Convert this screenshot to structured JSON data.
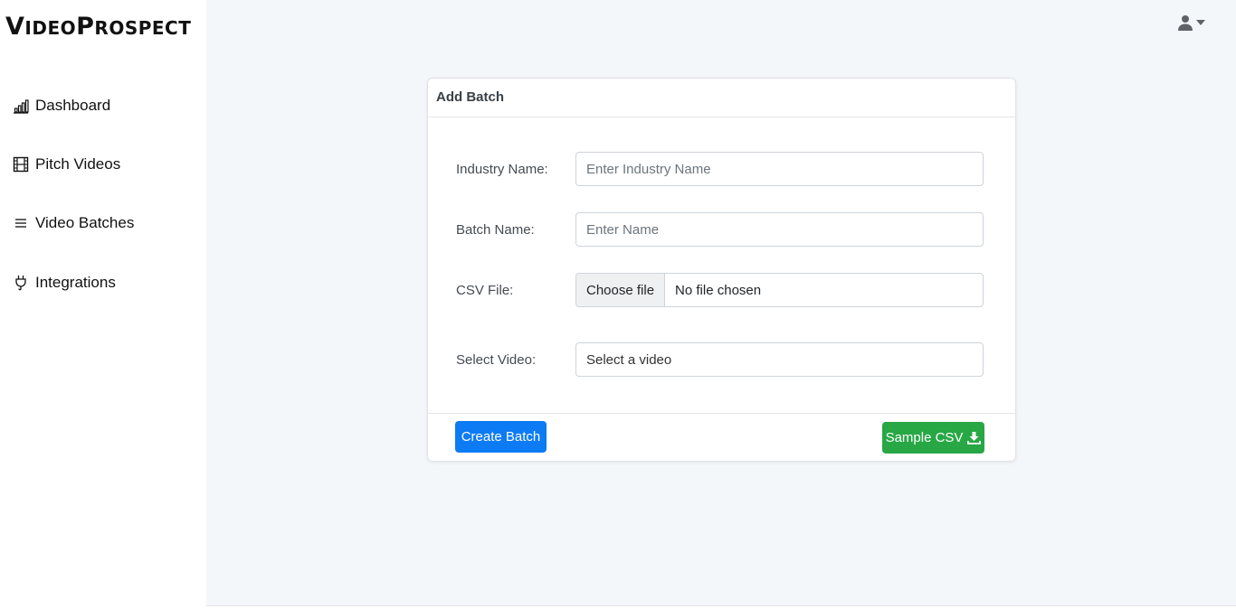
{
  "brand": {
    "first_big": "V",
    "first_rest": "IDEO",
    "second_big": "P",
    "second_rest": "ROSPECT"
  },
  "sidebar": {
    "items": [
      {
        "label": "Dashboard",
        "icon": "bar-chart-icon"
      },
      {
        "label": "Pitch Videos",
        "icon": "film-icon"
      },
      {
        "label": "Video Batches",
        "icon": "list-icon"
      },
      {
        "label": "Integrations",
        "icon": "plug-icon"
      }
    ]
  },
  "header": {
    "user_icon": "user-icon",
    "dropdown_icon": "caret-down-icon"
  },
  "card": {
    "title": "Add Batch",
    "fields": {
      "industry": {
        "label": "Industry Name:",
        "placeholder": "Enter Industry Name",
        "value": ""
      },
      "batch": {
        "label": "Batch Name:",
        "placeholder": "Enter Name",
        "value": ""
      },
      "csv": {
        "label": "CSV File:",
        "button": "Choose file",
        "status": "No file chosen"
      },
      "video": {
        "label": "Select Video:",
        "selected": "Select a video"
      }
    },
    "buttons": {
      "create": "Create Batch",
      "sample": "Sample CSV",
      "sample_icon": "download-icon"
    }
  },
  "colors": {
    "primary": "#0d7bf4",
    "success": "#28a745",
    "background": "#f4f7fa"
  }
}
